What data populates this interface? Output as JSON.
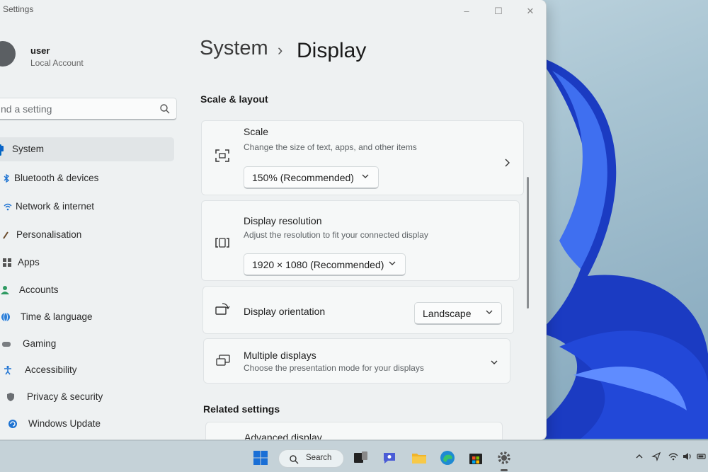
{
  "window": {
    "title": "Settings"
  },
  "user": {
    "name": "user",
    "account_type": "Local Account"
  },
  "search": {
    "placeholder": "nd a setting"
  },
  "nav": [
    {
      "label": "System",
      "icon": "monitor-icon"
    },
    {
      "label": "Bluetooth & devices",
      "icon": "bluetooth-icon"
    },
    {
      "label": "Network & internet",
      "icon": "wifi-icon"
    },
    {
      "label": "Personalisation",
      "icon": "brush-icon"
    },
    {
      "label": "Apps",
      "icon": "apps-icon"
    },
    {
      "label": "Accounts",
      "icon": "person-icon"
    },
    {
      "label": "Time & language",
      "icon": "globe-icon"
    },
    {
      "label": "Gaming",
      "icon": "gamepad-icon"
    },
    {
      "label": "Accessibility",
      "icon": "accessibility-icon"
    },
    {
      "label": "Privacy & security",
      "icon": "shield-icon"
    },
    {
      "label": "Windows Update",
      "icon": "update-icon"
    }
  ],
  "breadcrumb": {
    "parent": "System",
    "separator": "›",
    "current": "Display"
  },
  "sections": {
    "scale_layout": "Scale & layout",
    "related": "Related settings"
  },
  "scale": {
    "title": "Scale",
    "subtitle": "Change the size of text, apps, and other items",
    "value": "150% (Recommended)"
  },
  "resolution": {
    "title": "Display resolution",
    "subtitle": "Adjust the resolution to fit your connected display",
    "value": "1920 × 1080 (Recommended)"
  },
  "orientation": {
    "title": "Display orientation",
    "value": "Landscape"
  },
  "multiple": {
    "title": "Multiple displays",
    "subtitle": "Choose the presentation mode for your displays"
  },
  "advanced": {
    "title": "Advanced display"
  },
  "taskbar": {
    "search_label": "Search"
  },
  "colors": {
    "accent": "#0067c0",
    "wallpaper_bloom": "#1a3fc8"
  }
}
